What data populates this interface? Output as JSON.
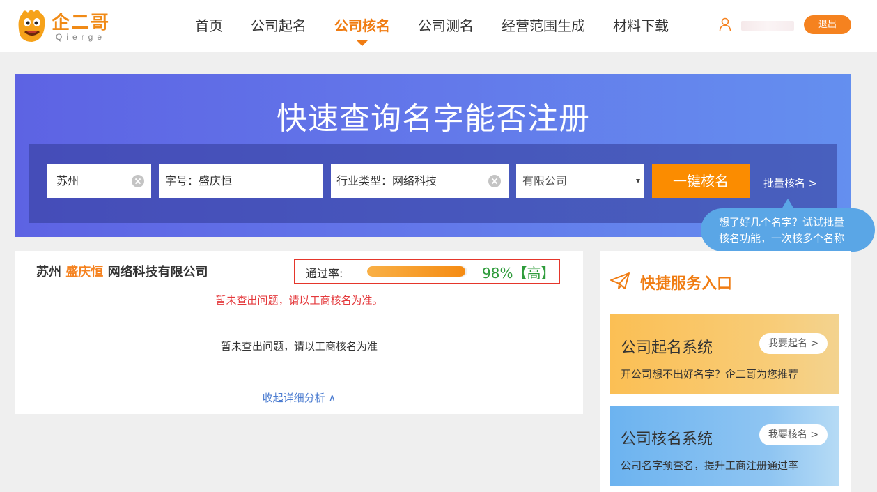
{
  "header": {
    "logo_text": "企二哥",
    "logo_sub": "Qierge",
    "nav": [
      {
        "label": "首页",
        "active": false
      },
      {
        "label": "公司起名",
        "active": false
      },
      {
        "label": "公司核名",
        "active": true
      },
      {
        "label": "公司测名",
        "active": false
      },
      {
        "label": "经营范围生成",
        "active": false
      },
      {
        "label": "材料下载",
        "active": false
      }
    ],
    "logout_label": "退出"
  },
  "banner": {
    "title": "快速查询名字能否注册",
    "city_value": "苏州",
    "brand_label": "字号：",
    "brand_value": "盛庆恒",
    "industry_label": "行业类型：",
    "industry_value": "网络科技",
    "company_type_value": "有限公司",
    "check_button": "一键核名",
    "batch_link": "批量核名 >",
    "tooltip_line1": "想了好几个名字？试试批量",
    "tooltip_line2": "核名功能，一次核多个名称"
  },
  "result": {
    "company_prefix": "苏州",
    "company_highlight": "盛庆恒",
    "company_suffix": "网络科技有限公司",
    "rate_label": "通过率:",
    "rate_percent": 98,
    "rate_value": "98%【高】",
    "warning": "暂未查出问题，请以工商核名为准。",
    "info": "暂未查出问题，请以工商核名为准",
    "collapse_label": "收起详细分析 ∧"
  },
  "sidebar": {
    "title": "快捷服务入口",
    "cards": [
      {
        "title": "公司起名系统",
        "button": "我要起名 >",
        "desc": "开公司想不出好名字？企二哥为您推荐"
      },
      {
        "title": "公司核名系统",
        "button": "我要核名 >",
        "desc": "公司名字预查名，提升工商注册通过率"
      }
    ]
  },
  "colors": {
    "accent": "#f5821f",
    "banner_start": "#5d63e3",
    "banner_end": "#648fef",
    "success": "#2e9b3a",
    "error": "#e4393c"
  }
}
